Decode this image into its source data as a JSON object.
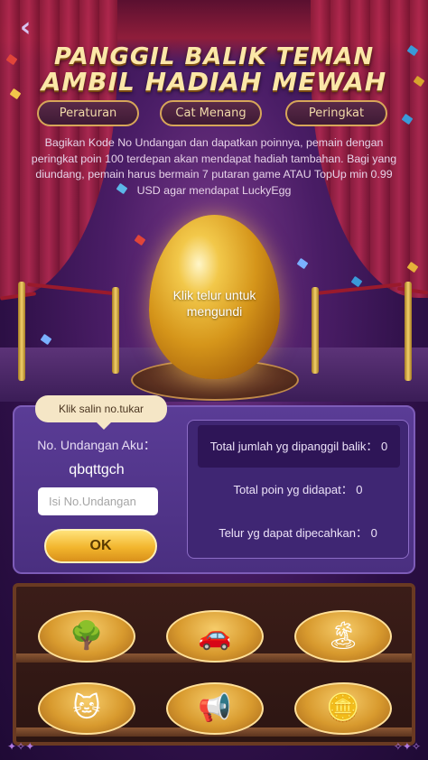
{
  "header": {
    "back_icon": "chevron-left-icon",
    "title_line1": "PANGGIL BALIK TEMAN",
    "title_line2": "AMBIL HADIAH MEWAH"
  },
  "tabs": [
    {
      "label": "Peraturan"
    },
    {
      "label": "Cat Menang"
    },
    {
      "label": "Peringkat"
    }
  ],
  "description": "Bagikan Kode No Undangan dan dapatkan poinnya, pemain dengan peringkat poin 100 terdepan akan mendapat hadiah tambahan. Bagi yang diundang, pemain harus bermain 7 putaran game ATAU TopUp min 0.99 USD agar mendapat LuckyEgg",
  "egg": {
    "prompt": "Klik telur untuk mengundi"
  },
  "invite": {
    "tooltip": "Klik salin no.tukar",
    "my_code_label": "No. Undangan Aku：",
    "my_code": "qbqttgch",
    "input_placeholder": "Isi No.Undangan",
    "input_value": "",
    "ok_label": "OK"
  },
  "stats": {
    "total_invited": "Total jumlah yg dipanggil balik： 0",
    "total_points": "Total poin yg didapat： 0",
    "eggs_broken": "Telur yg dapat dipecahkan： 0"
  },
  "prizes": [
    {
      "name": "bonsai-tree-icon",
      "glyph": "🌳"
    },
    {
      "name": "sports-car-icon",
      "glyph": "🚗"
    },
    {
      "name": "island-icon",
      "glyph": "🏝"
    },
    {
      "name": "lucky-cat-icon",
      "glyph": "🐱"
    },
    {
      "name": "megaphone-icon",
      "glyph": "📢"
    },
    {
      "name": "coins-icon",
      "glyph": "🪙"
    }
  ],
  "colors": {
    "accent_gold": "#f2b52d",
    "panel_purple": "#5a3c96",
    "title_cream": "#fbe7a8"
  }
}
